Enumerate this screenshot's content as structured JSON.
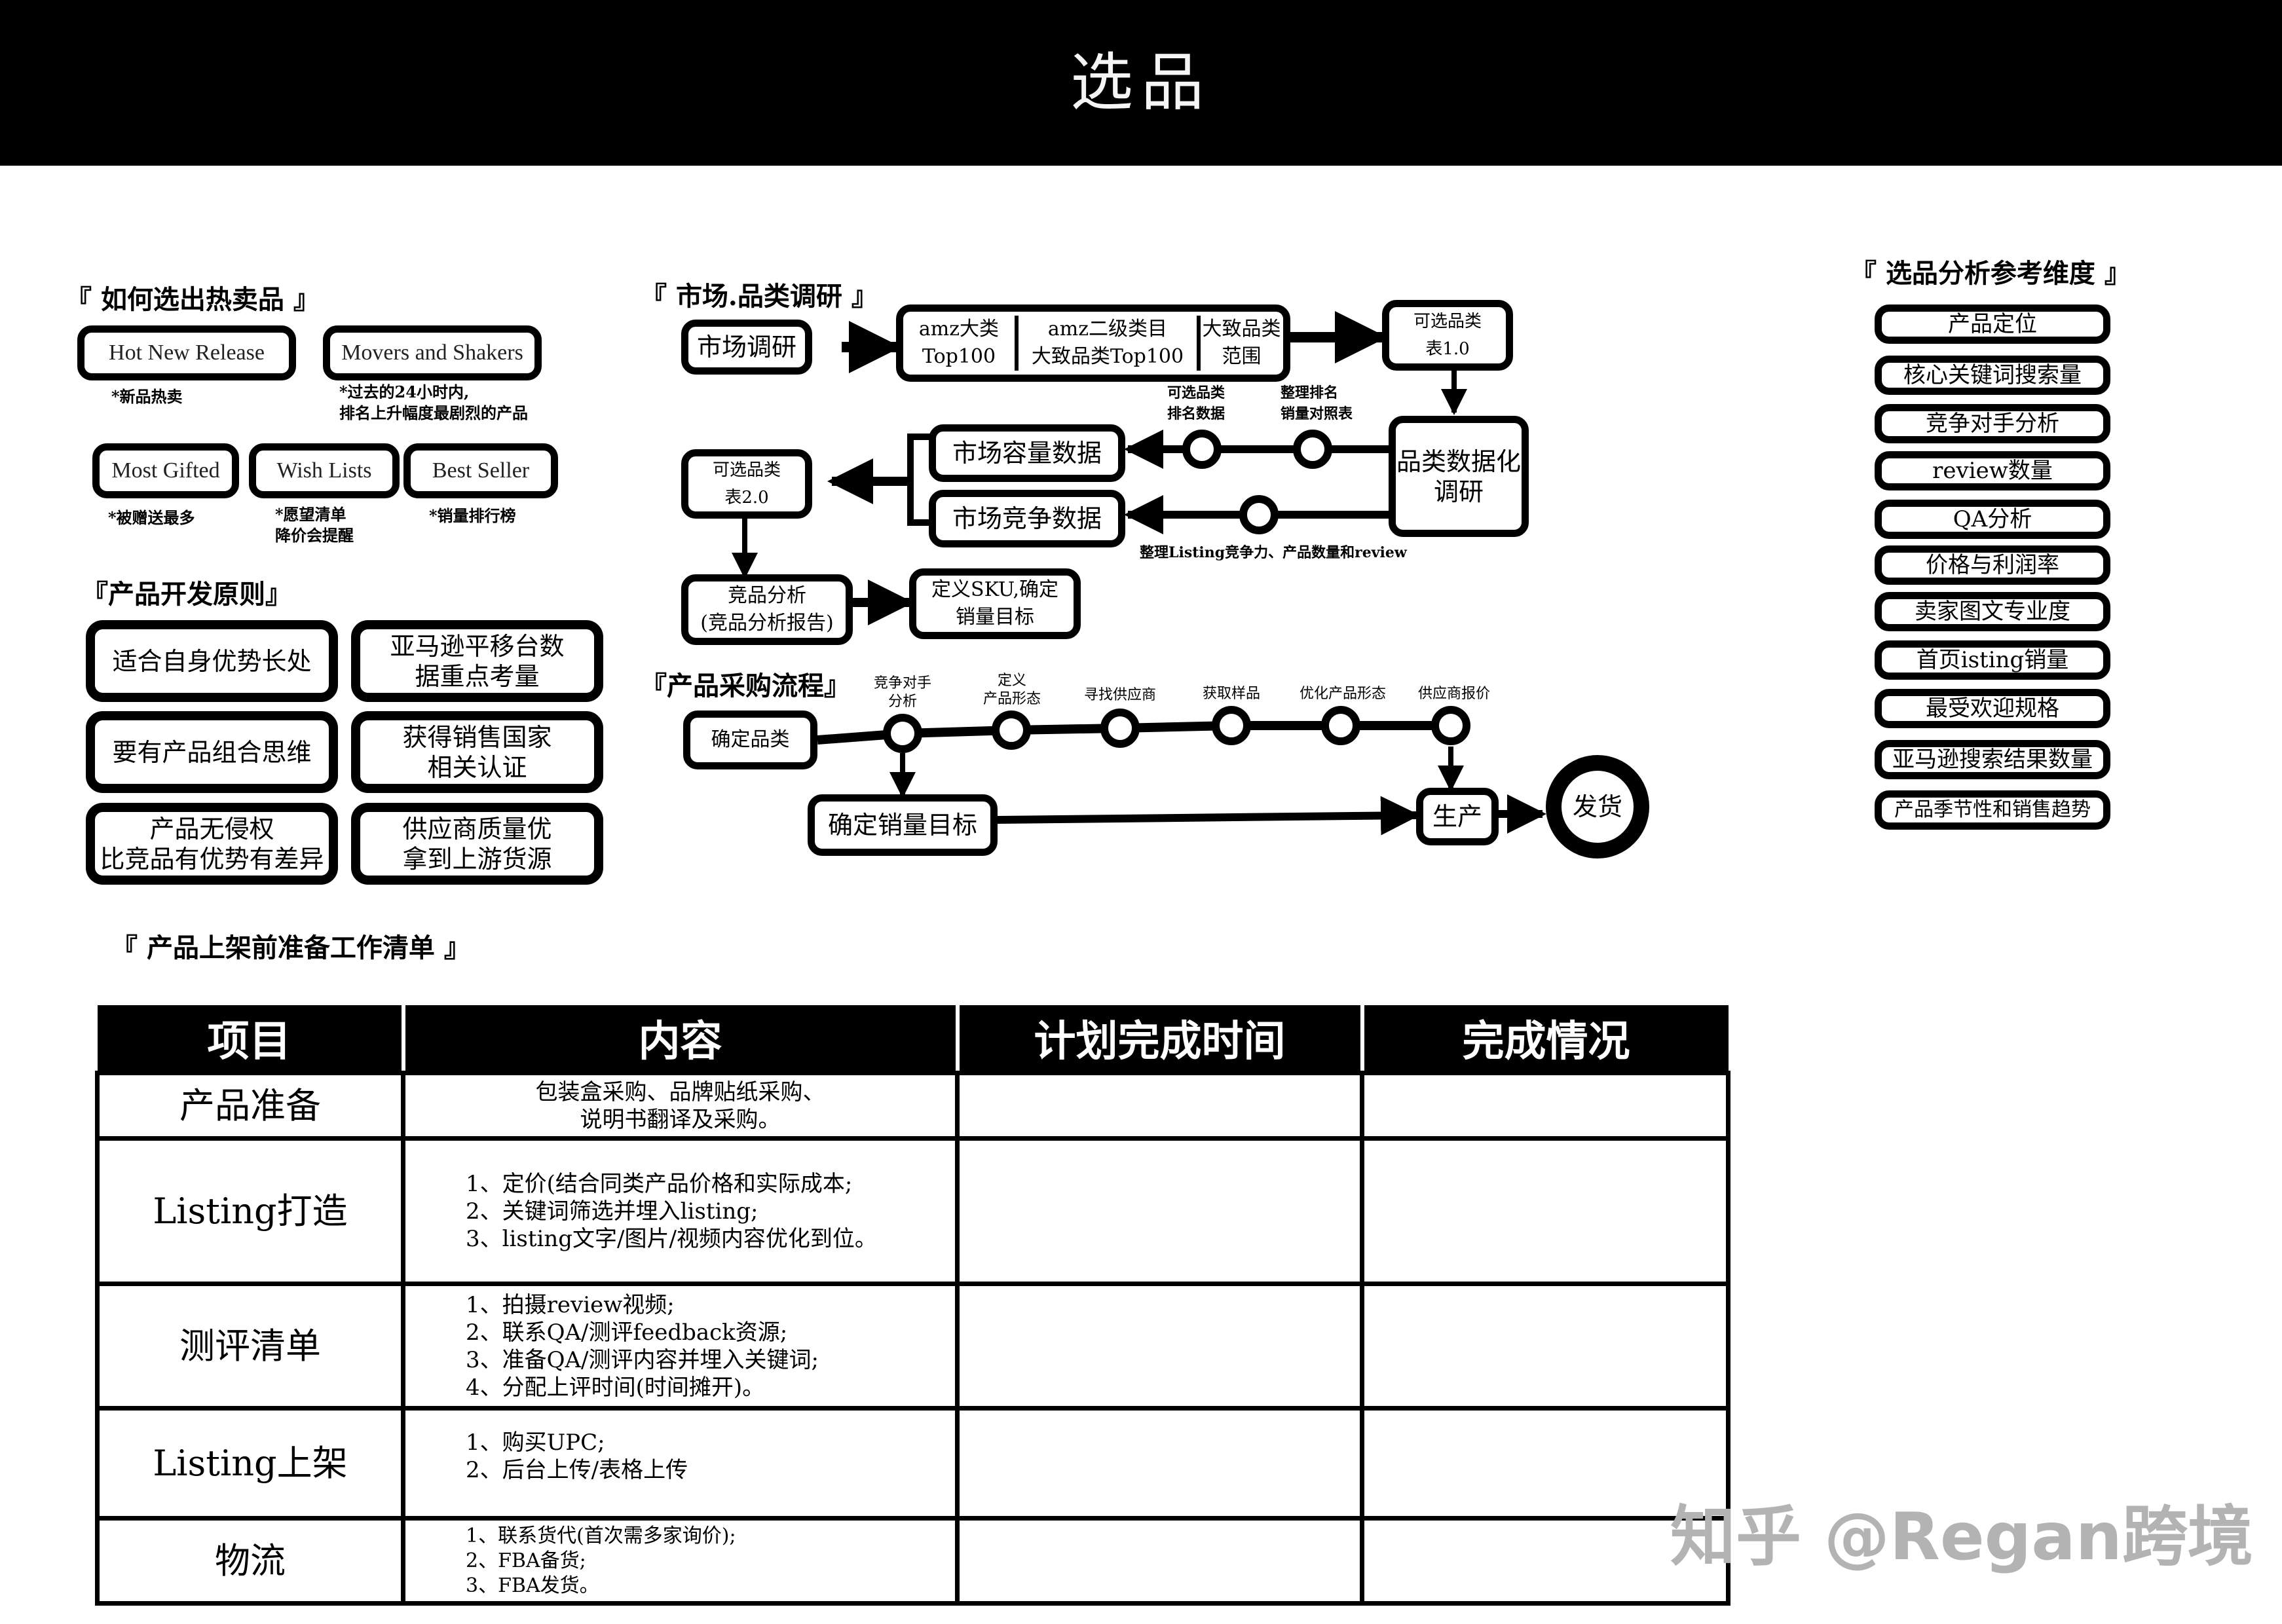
{
  "header": {
    "title": "选品"
  },
  "hot_products": {
    "title": "如何选出热卖品",
    "lists": [
      {
        "label": "Hot New Release",
        "note": [
          "*新品热卖"
        ]
      },
      {
        "label": "Movers and Shakers",
        "note": [
          "*过去的24小时内,",
          "排名上升幅度最剧烈的产品"
        ]
      },
      {
        "label": "Most Gifted",
        "note": [
          "*被赠送最多"
        ]
      },
      {
        "label": "Wish Lists",
        "note": [
          "*愿望清单",
          "降价会提醒"
        ]
      },
      {
        "label": "Best Seller",
        "note": [
          "*销量排行榜"
        ]
      }
    ]
  },
  "dev_principles": {
    "title": "产品开发原则",
    "items": [
      [
        "适合自身优势长处"
      ],
      [
        "亚马逊平移台数",
        "据重点考量"
      ],
      [
        "要有产品组合思维"
      ],
      [
        "获得销售国家",
        "相关认证"
      ],
      [
        "产品无侵权",
        "比竞品有优势有差异"
      ],
      [
        "供应商质量优",
        "拿到上游货源"
      ]
    ]
  },
  "market_research": {
    "title": "市场.品类调研",
    "start": "市场调研",
    "category_cells": [
      [
        "amz大类",
        "Top100"
      ],
      [
        "amz二级类目",
        "大致品类Top100"
      ],
      [
        "大致品类",
        "范围"
      ]
    ],
    "table_v1": [
      "可选品类",
      "表1.0"
    ],
    "data_research": [
      "品类数据化",
      "调研"
    ],
    "node_labels": [
      [
        "可选品类",
        "排名数据"
      ],
      [
        "整理排名",
        "销量对照表"
      ]
    ],
    "capacity": "市场容量数据",
    "competition": "市场竞争数据",
    "competition_note": "整理Listing竞争力、产品数量和review",
    "table_v2": [
      "可选品类",
      "表2.0"
    ],
    "competitor_analysis": [
      "竞品分析",
      "(竞品分析报告)"
    ],
    "define_sku": [
      "定义SKU,确定",
      "销量目标"
    ]
  },
  "procurement": {
    "title": "产品采购流程",
    "start": "确定品类",
    "steps": [
      [
        "竞争对手",
        "分析"
      ],
      [
        "定义",
        "产品形态"
      ],
      [
        "寻找供应商"
      ],
      [
        "获取样品"
      ],
      [
        "优化产品形态"
      ],
      [
        "供应商报价"
      ]
    ],
    "sales_target": "确定销量目标",
    "production": "生产",
    "shipping": "发货"
  },
  "dimensions": {
    "title": "选品分析参考维度",
    "items": [
      "产品定位",
      "核心关键词搜索量",
      "竞争对手分析",
      "review数量",
      "QA分析",
      "价格与利润率",
      "卖家图文专业度",
      "首页isting销量",
      "最受欢迎规格",
      "亚马逊搜索结果数量",
      "产品季节性和销售趋势"
    ]
  },
  "checklist": {
    "title": "产品上架前准备工作清单",
    "columns": [
      "项目",
      "内容",
      "计划完成时间",
      "完成情况"
    ],
    "rows": [
      {
        "item": "产品准备",
        "content": [
          "包装盒采购、品牌贴纸采购、",
          "说明书翻译及采购。"
        ],
        "planned": "",
        "status": ""
      },
      {
        "item": "Listing打造",
        "content": [
          "1、定价(结合同类产品价格和实际成本;",
          "2、关键词筛选并埋入listing;",
          "3、listing文字/图片/视频内容优化到位。"
        ],
        "planned": "",
        "status": ""
      },
      {
        "item": "测评清单",
        "content": [
          "1、拍摄review视频;",
          "2、联系QA/测评feedback资源;",
          "3、准备QA/测评内容并埋入关键词;",
          "4、分配上评时间(时间摊开)。"
        ],
        "planned": "",
        "status": ""
      },
      {
        "item": "Listing上架",
        "content": [
          "1、购买UPC;",
          "2、后台上传/表格上传"
        ],
        "planned": "",
        "status": ""
      },
      {
        "item": "物流",
        "content": [
          "1、联系货代(首次需多家询价);",
          "2、FBA备货;",
          "3、FBA发货。"
        ],
        "planned": "",
        "status": ""
      }
    ]
  },
  "watermark": "知乎 @Regan跨境",
  "brackets": {
    "open": "『",
    "close": "』"
  }
}
